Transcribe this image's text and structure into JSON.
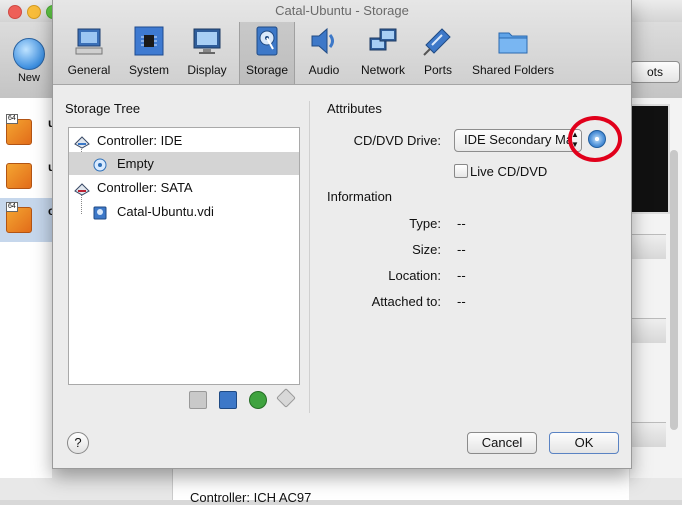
{
  "background": {
    "new_label": "New",
    "snapshots_label": "ots",
    "vm_badges": [
      "64",
      "",
      "64"
    ],
    "vm_initials": [
      "u",
      "u",
      "c"
    ],
    "bottom_text": "Controller:   ICH AC97"
  },
  "dialog": {
    "title": "Catal-Ubuntu - Storage",
    "toolbar": [
      {
        "label": "General",
        "icon": "general-icon"
      },
      {
        "label": "System",
        "icon": "system-chip-icon"
      },
      {
        "label": "Display",
        "icon": "display-icon"
      },
      {
        "label": "Storage",
        "icon": "storage-disk-icon",
        "active": true
      },
      {
        "label": "Audio",
        "icon": "speaker-icon"
      },
      {
        "label": "Network",
        "icon": "network-icon"
      },
      {
        "label": "Ports",
        "icon": "ports-icon"
      },
      {
        "label": "Shared Folders",
        "icon": "folder-icon"
      }
    ],
    "storage_tree": {
      "heading": "Storage Tree",
      "items": [
        {
          "label": "Controller: IDE",
          "icon": "ide-controller-icon"
        },
        {
          "label": "Empty",
          "icon": "cd-icon",
          "selected": true
        },
        {
          "label": "Controller: SATA",
          "icon": "sata-controller-icon"
        },
        {
          "label": "Catal-Ubuntu.vdi",
          "icon": "hard-disk-icon"
        }
      ],
      "tools": [
        "add-attachment-icon",
        "remove-attachment-icon",
        "add-controller-icon",
        "remove-controller-icon"
      ]
    },
    "attributes": {
      "heading": "Attributes",
      "cd_drive_label": "CD/DVD Drive:",
      "cd_drive_value": "IDE Secondary Master",
      "live_cd_label": "Live CD/DVD",
      "live_cd_checked": false
    },
    "information": {
      "heading": "Information",
      "rows": [
        {
          "label": "Type:",
          "value": "--"
        },
        {
          "label": "Size:",
          "value": "--"
        },
        {
          "label": "Location:",
          "value": "--"
        },
        {
          "label": "Attached to:",
          "value": "--"
        }
      ]
    },
    "help_label": "?",
    "cancel_label": "Cancel",
    "ok_label": "OK",
    "highlight_color": "#e1001b"
  }
}
